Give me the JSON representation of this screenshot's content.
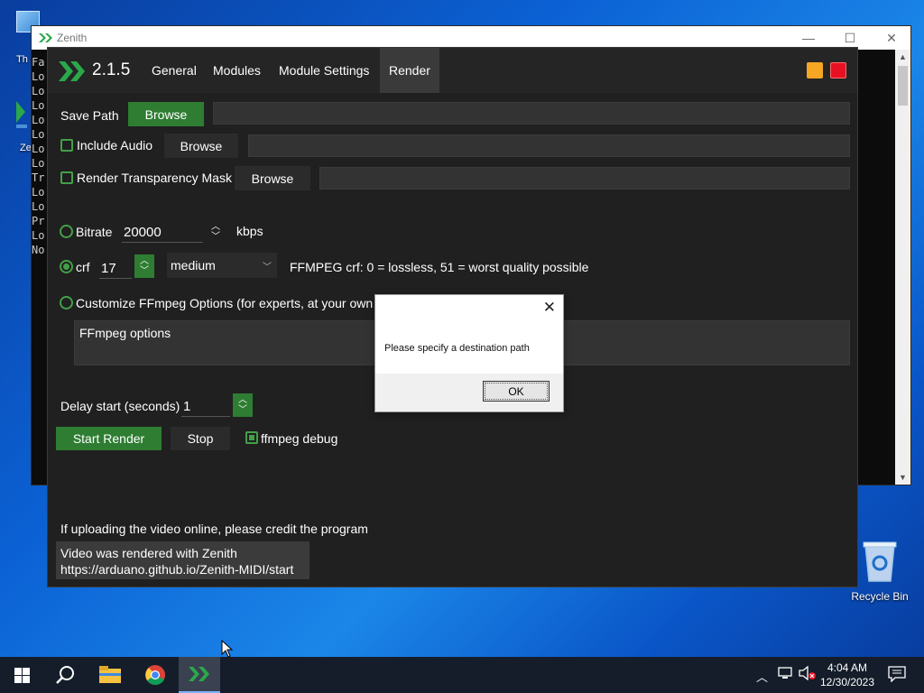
{
  "desktop": {
    "recycle_bin_label": "Recycle Bin",
    "left_shortcut_fragments": [
      "Th",
      "Ze"
    ]
  },
  "console": {
    "title": "Zenith",
    "minimize_glyph": "—",
    "maximize_glyph": "☐",
    "close_glyph": "✕",
    "lines": [
      "Fa",
      "Lo",
      "Lo",
      "Lo",
      "Lo",
      "Lo",
      "Lo",
      "Lo",
      "Tr",
      "Lo",
      "Lo",
      "Pr",
      "Lo",
      "No"
    ]
  },
  "app": {
    "version": "2.1.5",
    "tabs": [
      "General",
      "Modules",
      "Module Settings",
      "Render"
    ],
    "active_tab": "Render",
    "colors": {
      "accent": "#2e7d32",
      "minimize": "#f5a623",
      "close": "#e81123"
    },
    "save_path": {
      "label": "Save Path",
      "browse_label": "Browse",
      "value": ""
    },
    "include_audio": {
      "label": "Include Audio",
      "browse_label": "Browse",
      "checked": false,
      "value": ""
    },
    "transparency_mask": {
      "label": "Render Transparency Mask",
      "browse_label": "Browse",
      "checked": false,
      "value": ""
    },
    "bitrate": {
      "label": "Bitrate",
      "value": "20000",
      "unit": "kbps",
      "selected": false
    },
    "crf": {
      "label": "crf",
      "value": "17",
      "preset": "medium",
      "note": "FFMPEG crf: 0 = lossless, 51 = worst quality possible",
      "selected": true
    },
    "custom": {
      "label": "Customize FFmpeg Options (for experts, at your own",
      "placeholder": "FFmpeg options",
      "selected": false
    },
    "delay": {
      "label": "Delay start (seconds)",
      "value": "1"
    },
    "start_render_label": "Start Render",
    "stop_label": "Stop",
    "ffmpeg_debug": {
      "label": "ffmpeg debug",
      "checked": true
    },
    "credit_heading": "If uploading the video online, please credit the program",
    "credit_lines": [
      "Video was rendered with Zenith",
      "https://arduano.github.io/Zenith-MIDI/start"
    ]
  },
  "dialog": {
    "message": "Please specify a destination path",
    "ok_label": "OK",
    "close_glyph": "✕"
  },
  "taskbar": {
    "time": "4:04 AM",
    "date": "12/30/2023",
    "tray_chevron": "︿"
  }
}
